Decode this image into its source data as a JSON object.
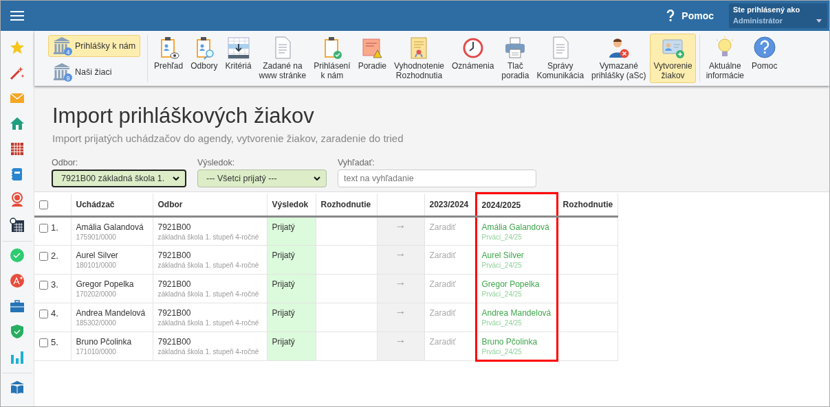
{
  "top_bar": {
    "help": "Pomoc",
    "user_label": "Ste prihlásený ako",
    "user_name": "Administrátor"
  },
  "toolbar": {
    "left_buttons": [
      {
        "label": "Prihlášky k nám",
        "badge": "4",
        "selected": true
      },
      {
        "label": "Naši žiaci",
        "badge": "9",
        "selected": false
      }
    ],
    "items": [
      {
        "label": "Prehľad",
        "selected": false
      },
      {
        "label": "Odbory",
        "selected": false
      },
      {
        "label": "Kritériá",
        "selected": false
      },
      {
        "label": "Zadané na\nwww stránke",
        "selected": false
      },
      {
        "label": "Prihlásení\nk nám",
        "selected": false
      },
      {
        "label": "Poradie",
        "selected": false
      },
      {
        "label": "Vyhodnotenie\nRozhodnutia",
        "selected": false
      },
      {
        "label": "Oznámenia",
        "selected": false
      },
      {
        "label": "Tlač\nporadia",
        "selected": false
      },
      {
        "label": "Správy\nKomunikácia",
        "selected": false
      },
      {
        "label": "Vymazané\nprihlášky (aSc)",
        "selected": false
      },
      {
        "label": "Vytvorenie\nžiakov",
        "selected": true
      },
      {
        "label": "Aktuálne\ninformácie",
        "selected": false
      },
      {
        "label": "Pomoc",
        "selected": false
      }
    ]
  },
  "page": {
    "title": "Import prihláškových žiakov",
    "subtitle": "Import prijatých uchádzačov do agendy, vytvorenie žiakov, zaradenie do tried"
  },
  "filters": {
    "odbor": {
      "label": "Odbor:",
      "value": "7921B00 základná škola 1."
    },
    "vysledok": {
      "label": "Výsledok:",
      "value": "--- Všetci prijatý ---"
    },
    "search": {
      "label": "Vyhľadať:",
      "placeholder": "text na vyhľadanie"
    }
  },
  "table": {
    "select_all_checked": false,
    "columns": [
      {
        "label": "Uchádzač",
        "highlighted": false
      },
      {
        "label": "Odbor",
        "highlighted": false
      },
      {
        "label": "Výsledok",
        "highlighted": false
      },
      {
        "label": "Rozhodnutie",
        "highlighted": false
      },
      {
        "label": "2023/2024",
        "highlighted": false
      },
      {
        "label": "2024/2025",
        "highlighted": true
      },
      {
        "label": "Rozhodnutie",
        "highlighted": false
      }
    ],
    "rows": [
      {
        "checked": false,
        "number": "1.",
        "name": "Amália Galandová",
        "id": "175901/0000",
        "odbor_code": "7921B00",
        "odbor_name": "základná škola 1. stupeň 4-ročné",
        "result": "Prijatý",
        "arrow": "→",
        "action": "Zaradiť",
        "new_name": "Amália Galandová",
        "new_class": "Prváci_24/25"
      },
      {
        "checked": false,
        "number": "2.",
        "name": "Aurel Silver",
        "id": "180101/0000",
        "odbor_code": "7921B00",
        "odbor_name": "základná škola 1. stupeň 4-ročné",
        "result": "Prijatý",
        "arrow": "→",
        "action": "Zaradiť",
        "new_name": "Aurel Silver",
        "new_class": "Prváci_24/25"
      },
      {
        "checked": false,
        "number": "3.",
        "name": "Gregor Popelka",
        "id": "170202/0000",
        "odbor_code": "7921B00",
        "odbor_name": "základná škola 1. stupeň 4-ročné",
        "result": "Prijatý",
        "arrow": "→",
        "action": "Zaradiť",
        "new_name": "Gregor Popelka",
        "new_class": "Prváci_24/25"
      },
      {
        "checked": false,
        "number": "4.",
        "name": "Andrea Mandelová",
        "id": "185302/0000",
        "odbor_code": "7921B00",
        "odbor_name": "základná škola 1. stupeň 4-ročné",
        "result": "Prijatý",
        "arrow": "→",
        "action": "Zaradiť",
        "new_name": "Andrea Mandelová",
        "new_class": "Prváci_24/25"
      },
      {
        "checked": false,
        "number": "5.",
        "name": "Bruno Pčolinka",
        "id": "171010/0000",
        "odbor_code": "7921B00",
        "odbor_name": "základná škola 1. stupeň 4-ročné",
        "result": "Prijatý",
        "arrow": "→",
        "action": "Zaradiť",
        "new_name": "Bruno Pčolinka",
        "new_class": "Prváci_24/25"
      }
    ]
  }
}
